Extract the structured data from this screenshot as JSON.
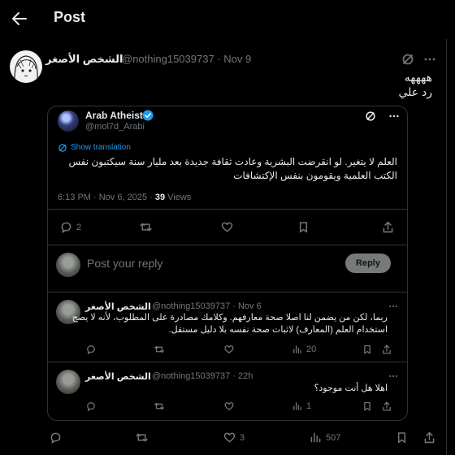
{
  "header": {
    "title": "Post"
  },
  "post": {
    "author_name": "الشخص الأصغر",
    "author_handle": "@nothing15039737",
    "date": "Nov 9",
    "text_line1": "ههههه",
    "text_line2": "رد علي",
    "actions": {
      "replies": "",
      "reposts": "",
      "likes": "3",
      "views": "507"
    }
  },
  "quote": {
    "author_name": "Arab Atheist",
    "author_handle": "@mol7d_Arabi",
    "show_translation": "Show translation",
    "text": "العلم لا يتغير. لو انقرضت البشرية وعادت ثقافة جديدة بعد مليار سنة سيكتبون نفس الكتب العلمية ويقومون بنفس الإكتشافات",
    "time": "6:13 PM · Nov 6, 2025 · ",
    "views_count": "39",
    "views_label": " Views",
    "actions": {
      "replies": "2"
    },
    "reply_placeholder": "Post your reply",
    "reply_button": "Reply"
  },
  "replies": [
    {
      "author_name": "الشخص الأصغر",
      "author_handle": "@nothing15039737 · Nov 6",
      "text": "ربما، لكن من يضمن لنا اصلا صحة معارفهم. وكلامك مصادرة على المطلوب، لأنه لا يصح استخدام العلم (المعارف) لاثبات صحة نفسه بلا دليل مستقل.",
      "views": "20"
    },
    {
      "author_name": "الشخص الأصغر",
      "author_handle": "@nothing15039737 · 22h",
      "text": "اهلا هل أنت موجود؟",
      "views": "1"
    }
  ],
  "icons": {
    "back": "arrow-left-icon",
    "grok": "grok-icon",
    "more": "more-icon",
    "reply": "reply-icon",
    "repost": "repost-icon",
    "like": "heart-icon",
    "views": "views-icon",
    "bookmark": "bookmark-icon",
    "share": "share-icon",
    "verified": "verified-badge-icon",
    "translate": "translate-icon"
  },
  "colors": {
    "accent": "#1d9bf0",
    "muted": "#71767b",
    "border": "#2f3336",
    "text": "#e7e9ea"
  }
}
